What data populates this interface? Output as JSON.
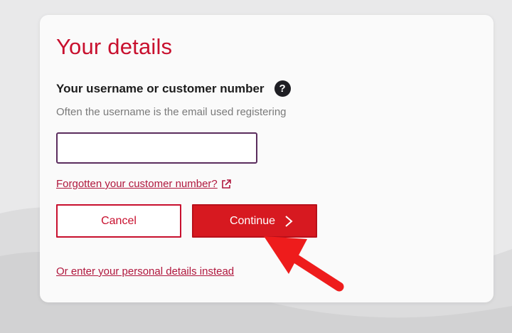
{
  "form": {
    "title": "Your details",
    "field_label": "Your username or customer number",
    "help_icon": "question-mark-icon",
    "help_glyph": "?",
    "hint": "Often the username is the email used registering",
    "input_value": "",
    "forgot_link": "Forgotten your customer number?",
    "forgot_icon": "external-link-icon",
    "cancel_label": "Cancel",
    "continue_label": "Continue",
    "continue_icon": "chevron-right-icon",
    "alt_link": "Or enter your personal details instead"
  },
  "colors": {
    "brand_red": "#c8102e",
    "button_red": "#d71920",
    "input_border": "#5b2d5e",
    "annotation_arrow": "#ee1c1c"
  }
}
